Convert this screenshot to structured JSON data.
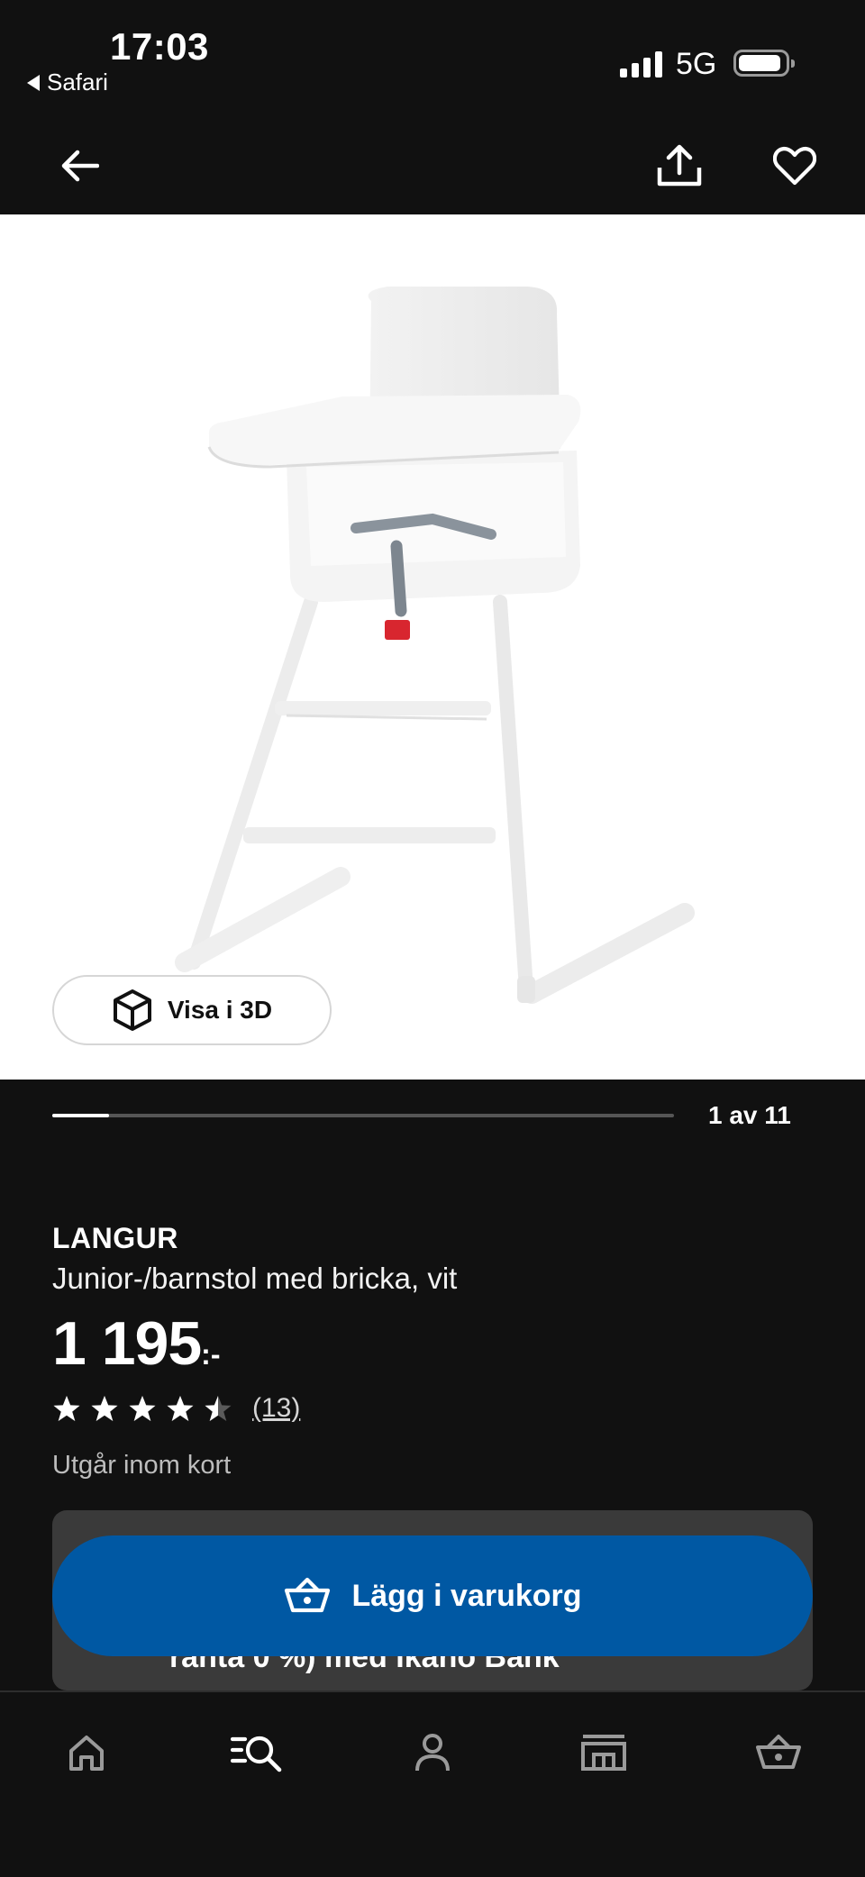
{
  "status_bar": {
    "time": "17:03",
    "back_app": "Safari",
    "network": "5G"
  },
  "top_nav": {
    "back_icon": "arrow-left-icon",
    "share_icon": "share-icon",
    "favorite_icon": "heart-icon"
  },
  "gallery": {
    "view_3d_label": "Visa i 3D",
    "counter": "1 av 11",
    "progress_fraction": 0.0909
  },
  "product": {
    "brand": "LANGUR",
    "description": "Junior-/barnstol med bricka, vit",
    "price": "1 195",
    "price_suffix": ":-",
    "rating": 4.5,
    "review_count": "(13)",
    "stock_note": "Utgår inom kort"
  },
  "finance": {
    "text": "ränta 0 %) med Ikano Bank"
  },
  "cta": {
    "add_to_cart": "Lägg i varukorg"
  },
  "tabbar": {
    "items": [
      "home-icon",
      "search-icon",
      "account-icon",
      "store-icon",
      "cart-icon"
    ]
  },
  "colors": {
    "background": "#111111",
    "primary_button": "#0058a3",
    "card": "#3a3a3a"
  }
}
